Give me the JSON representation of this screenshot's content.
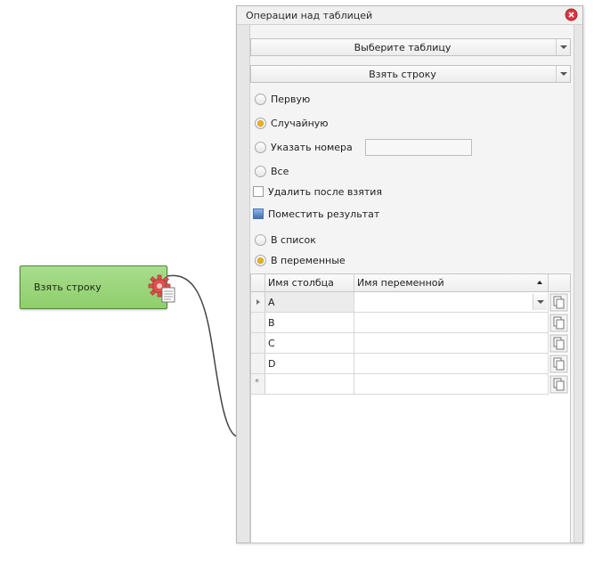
{
  "node": {
    "label": "Взять строку",
    "icon": "gear-document-icon"
  },
  "panel": {
    "title": "Операции над таблицей",
    "close_icon": "close-icon",
    "table_select": "Выберите таблицу",
    "operation_select": "Взять строку",
    "row_options": [
      {
        "label": "Первую",
        "checked": false
      },
      {
        "label": "Случайную",
        "checked": true
      },
      {
        "label": "Указать номера",
        "checked": false
      },
      {
        "label": "Все",
        "checked": false
      }
    ],
    "row_numbers_value": "",
    "delete_after": {
      "label": "Удалить после взятия",
      "checked": false
    },
    "put_result": {
      "label": "Поместить результат",
      "checked": true
    },
    "result_options": [
      {
        "label": "В список",
        "checked": false
      },
      {
        "label": "В переменные",
        "checked": true
      }
    ],
    "grid": {
      "columns": [
        "Имя столбца",
        "Имя переменной"
      ],
      "rows": [
        {
          "column": "A",
          "variable": ""
        },
        {
          "column": "B",
          "variable": ""
        },
        {
          "column": "C",
          "variable": ""
        },
        {
          "column": "D",
          "variable": ""
        },
        {
          "column": "",
          "variable": ""
        }
      ],
      "new_row_marker": "*",
      "copy_icon": "copy-icon"
    }
  },
  "colors": {
    "node_green": "#8fcf6c",
    "radio_selected": "#f2b318",
    "close_red": "#d9363e"
  }
}
